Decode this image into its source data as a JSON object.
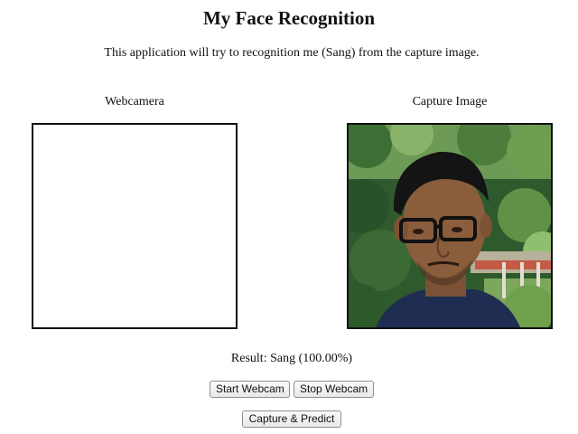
{
  "header": {
    "title": "My Face Recognition",
    "description": "This application will try to recognition me (Sang) from the capture image."
  },
  "webcam": {
    "label": "Webcamera"
  },
  "capture": {
    "label": "Capture Image"
  },
  "result": {
    "text": "Result: Sang (100.00%)"
  },
  "buttons": {
    "start_webcam": "Start Webcam",
    "stop_webcam": "Stop Webcam",
    "capture_predict": "Capture & Predict"
  }
}
